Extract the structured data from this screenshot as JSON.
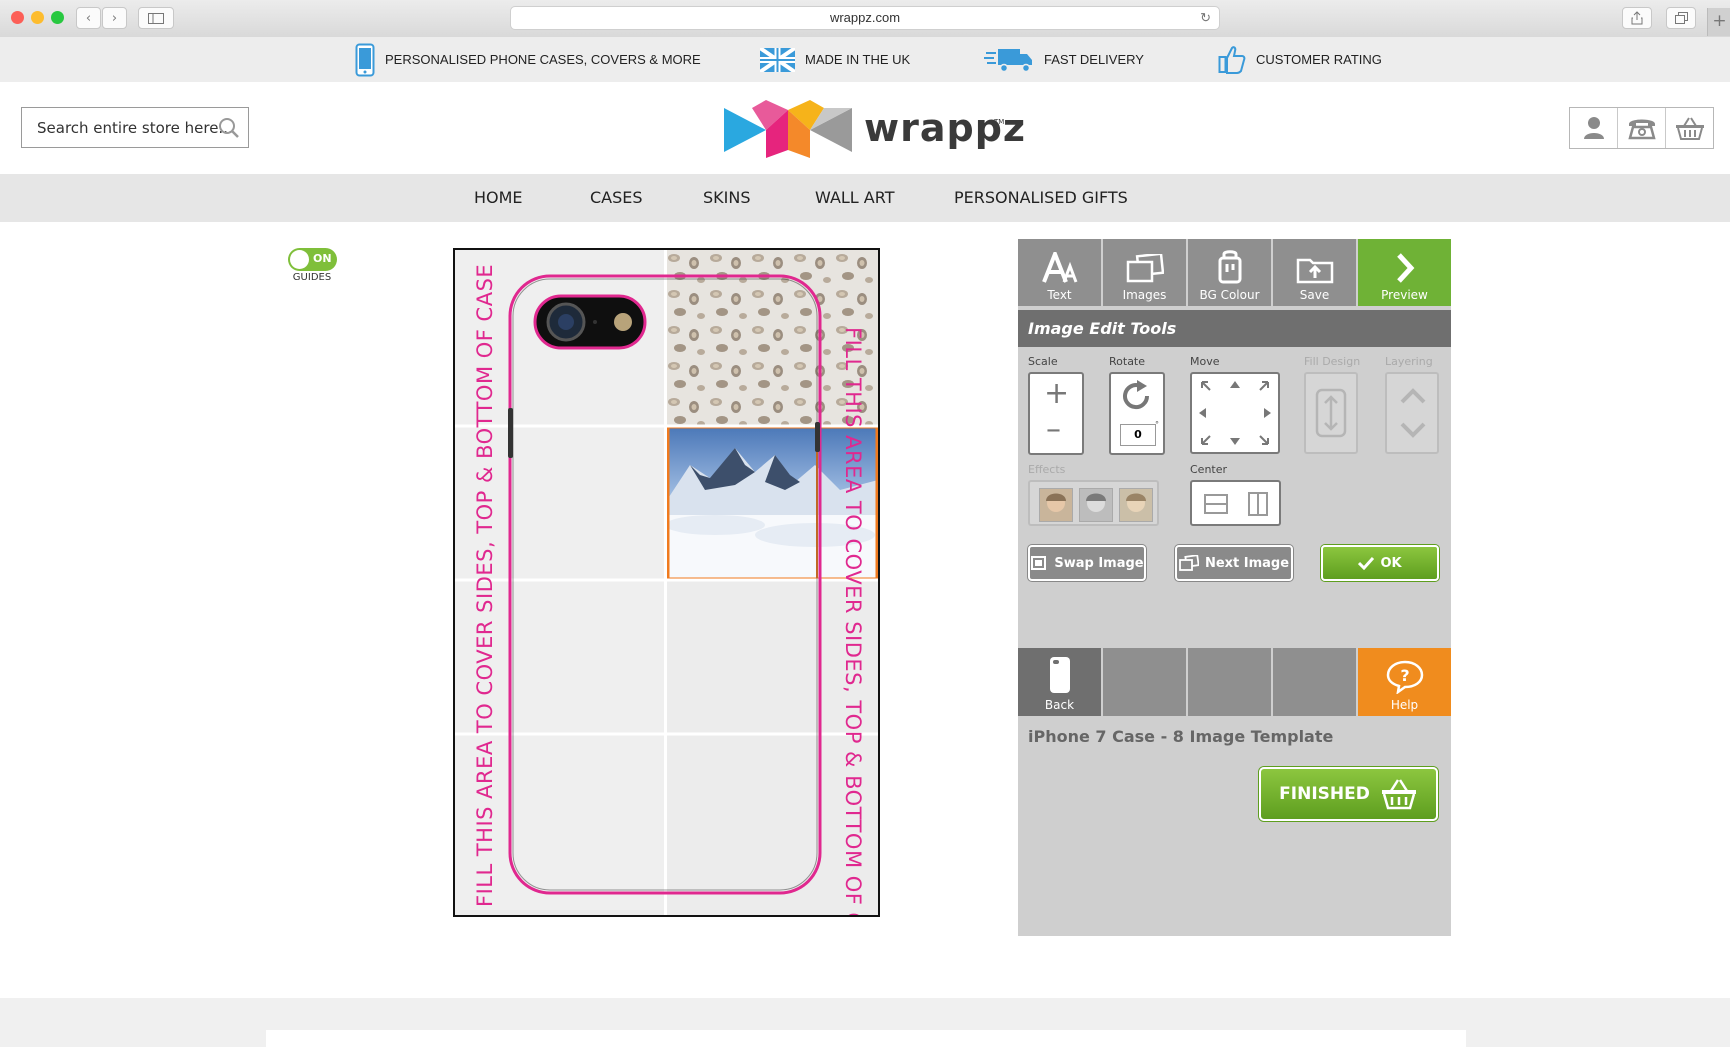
{
  "browser": {
    "url": "wrappz.com"
  },
  "usp_bar": [
    {
      "icon": "phone-icon",
      "label": "PERSONALISED PHONE CASES, COVERS & MORE"
    },
    {
      "icon": "uk-flag-icon",
      "label": "MADE IN THE UK"
    },
    {
      "icon": "delivery-truck-icon",
      "label": "FAST DELIVERY"
    },
    {
      "icon": "thumbs-up-icon",
      "label": "CUSTOMER RATING"
    }
  ],
  "header": {
    "search_placeholder": "Search entire store here...",
    "logo_text": "wrappz",
    "logo_tm": "TM"
  },
  "nav": [
    "HOME",
    "CASES",
    "SKINS",
    "WALL ART",
    "PERSONALISED GIFTS"
  ],
  "guides": {
    "toggle_label": "ON",
    "label": "GUIDES"
  },
  "canvas": {
    "guide_text": "FILL THIS AREA TO COVER SIDES, TOP & BOTTOM OF CASE"
  },
  "tools": {
    "tabs": [
      "Text",
      "Images",
      "BG Colour",
      "Save",
      "Preview"
    ],
    "title": "Image Edit Tools",
    "scale_label": "Scale",
    "rotate_label": "Rotate",
    "rotate_value": "0",
    "move_label": "Move",
    "fill_design_label": "Fill Design",
    "layering_label": "Layering",
    "effects_label": "Effects",
    "center_label": "Center",
    "swap_image": "Swap Image",
    "next_image": "Next Image",
    "ok": "OK",
    "back": "Back",
    "help": "Help",
    "product_title": "iPhone 7 Case - 8 Image Template",
    "finished": "FINISHED"
  },
  "colors": {
    "accent_green": "#7fbf3a",
    "help_orange": "#f08c1e",
    "guide_pink": "#e0288f"
  }
}
